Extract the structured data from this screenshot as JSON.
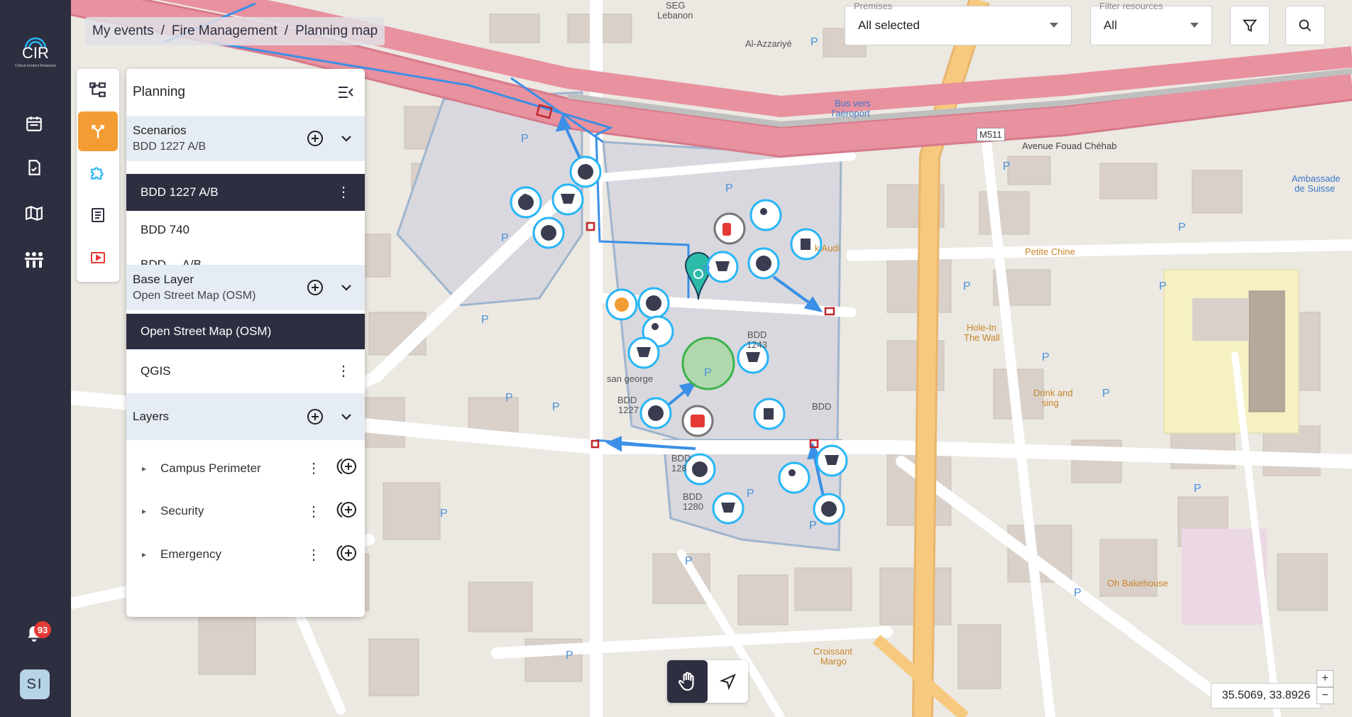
{
  "app": {
    "logo_text": "CIR",
    "logo_subtitle": "Critical Incident Response",
    "notification_count": "93",
    "user_initials": "SI"
  },
  "breadcrumb": {
    "items": [
      "My events",
      "Fire Management",
      "Planning map"
    ]
  },
  "panel": {
    "title": "Planning",
    "scenarios": {
      "title": "Scenarios",
      "current": "BDD 1227 A/B",
      "items": [
        "BDD 1227 A/B",
        "BDD 740",
        "BDD ... A/B ..."
      ]
    },
    "base_layer": {
      "title": "Base Layer",
      "current": "Open Street Map (OSM)",
      "items": [
        "Open Street Map (OSM)",
        "QGIS"
      ]
    },
    "layers": {
      "title": "Layers",
      "items": [
        "Campus Perimeter",
        "Security",
        "Emergency"
      ]
    }
  },
  "filters": {
    "premises_label": "Premises",
    "premises_value": "All selected",
    "resources_label": "Filter resources",
    "resources_value": "All"
  },
  "coords": "35.5069, 33.8926",
  "zoom": {
    "in": "+",
    "out": "−"
  },
  "map_labels": {
    "avenue": "Avenue Fouad Chéhab",
    "m511": "M511",
    "seg": "SEG",
    "lebanon": "Lebanon",
    "azzariye": "Al-Azzariyé",
    "bus": "Bus vers",
    "airport": "l'aéroport",
    "ambassade": "Ambassade",
    "suisse": "de Suisse",
    "petite_chine": "Petite Chine",
    "hole": "Hole-In",
    "wall": "The Wall",
    "drink": "Drink and",
    "sing": "sing",
    "san_george": "san george",
    "bdd_1227": "BDD",
    "bdd_1227b": "1227",
    "bdd_1243": "BDD",
    "bdd_1243b": "1243",
    "bdd_right": "BDD",
    "bdd_1280": "BDD",
    "bdd_1280b": "1280",
    "bdd_128": "BDD",
    "bdd_128b": "128",
    "oh_bakehouse": "Oh Bakehouse",
    "croissant": "Croissant",
    "margo": "Margo",
    "k_audi": "k Audi"
  },
  "colors": {
    "sidebar": "#2d2e40",
    "accent": "#f39c34",
    "resource_ring": "#29b6f6",
    "zone_fill": "#4caf50",
    "road_pink": "#e8919f",
    "road_orange": "#f7c97e"
  }
}
